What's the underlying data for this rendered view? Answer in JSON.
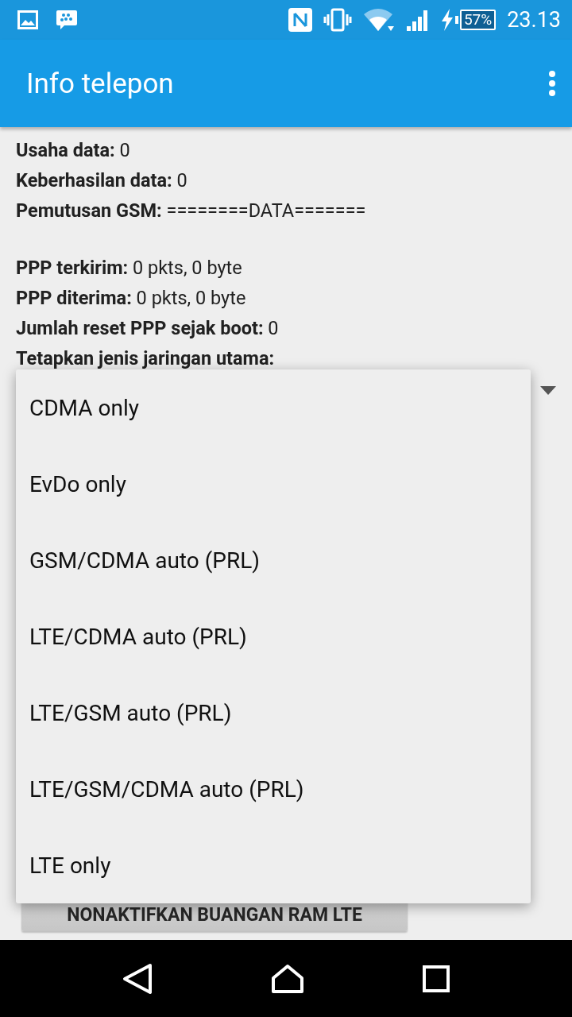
{
  "status_bar": {
    "battery": "57%",
    "time": "23.13"
  },
  "app_bar": {
    "title": "Info telepon"
  },
  "info_rows": [
    {
      "label": "Usaha data:",
      "value": "0"
    },
    {
      "label": "Keberhasilan data:",
      "value": "0"
    },
    {
      "label": "Pemutusan GSM:",
      "value": "========DATA======="
    },
    {
      "kind": "gap"
    },
    {
      "label": "PPP terkirim:",
      "value": "0 pkts, 0 byte"
    },
    {
      "label": "PPP diterima:",
      "value": "0 pkts, 0 byte"
    },
    {
      "label": "Jumlah reset PPP sejak boot:",
      "value": "0"
    },
    {
      "label": "Tetapkan jenis jaringan utama:"
    }
  ],
  "dump_button": "NONAKTIFKAN BUANGAN RAM LTE",
  "dropdown_menu": {
    "items": [
      "CDMA only",
      "EvDo only",
      "GSM/CDMA auto (PRL)",
      "LTE/CDMA auto (PRL)",
      "LTE/GSM auto (PRL)",
      "LTE/GSM/CDMA auto (PRL)",
      "LTE only"
    ]
  }
}
